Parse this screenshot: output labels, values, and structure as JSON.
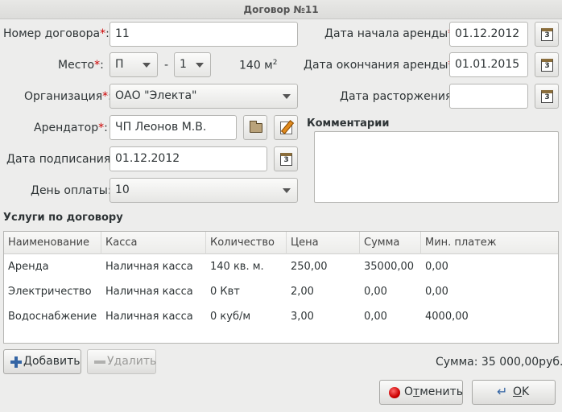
{
  "window": {
    "title": "Договор №11"
  },
  "form": {
    "contract_number_label": "Номер договора",
    "contract_number_value": "11",
    "place_label": "Место",
    "place_value_1": "П",
    "place_separator": "-",
    "place_value_2": "1",
    "area_value": "140 м",
    "area_unit_sup": "2",
    "organization_label": "Организация",
    "organization_value": "ОАО \"Электа\"",
    "tenant_label": "Арендатор",
    "tenant_value": "ЧП Леонов М.В.",
    "signed_date_label": "Дата подписания:",
    "signed_date_value": "01.12.2012",
    "payment_day_label": "День оплаты:",
    "payment_day_value": "10",
    "start_date_label": "Дата начала аренды",
    "start_date_value": "01.12.2012",
    "end_date_label": "Дата окончания аренды",
    "end_date_value": "01.01.2015",
    "termination_date_label": "Дата расторжения:",
    "termination_date_value": "",
    "comments_label": "Комментарии",
    "comments_value": "",
    "required_mark": "*",
    "colon": ":"
  },
  "services": {
    "title": "Услуги по договору",
    "columns": [
      "Наименование",
      "Касса",
      "Количество",
      "Цена",
      "Сумма",
      "Мин. платеж"
    ],
    "rows": [
      [
        "Аренда",
        "Наличная касса",
        "140 кв. м.",
        "250,00",
        "35000,00",
        "0,00"
      ],
      [
        "Электричество",
        "Наличная касса",
        "0 Квт",
        "2,00",
        "0,00",
        "0,00"
      ],
      [
        "Водоснабжение",
        "Наличная касса",
        "0 куб/м",
        "3,00",
        "0,00",
        "4000,00"
      ]
    ],
    "total_text": "Сумма: 35 000,00руб."
  },
  "buttons": {
    "add_label": "Добавить",
    "delete_label": "Удалить",
    "cancel_prefix": "О",
    "cancel_mnemonic": "т",
    "cancel_rest": "менить",
    "ok_mnemonic": "О",
    "ok_rest": "K"
  },
  "icons": {
    "calendar": "calendar-icon",
    "folder": "folder-open-icon",
    "edit": "edit-icon",
    "add": "plus-icon",
    "remove": "minus-icon",
    "cancel": "stop-icon",
    "ok": "ok-arrow-icon"
  }
}
